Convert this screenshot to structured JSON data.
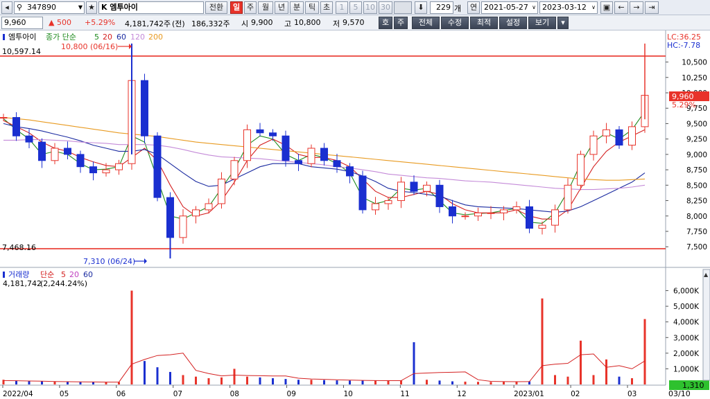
{
  "toolbar": {
    "code": "347890",
    "stock_prefix": "K",
    "stock_name": "엠투아이",
    "switch_label": "전환",
    "periods": [
      "일",
      "주",
      "월",
      "년",
      "분",
      "틱",
      "초"
    ],
    "active_period": "일",
    "minute_options": [
      "1",
      "5",
      "10",
      "30"
    ],
    "count_value": "229",
    "count_unit": "개",
    "span_label": "연",
    "date_from": "2021-05-27",
    "date_to": "2023-03-12"
  },
  "quote": {
    "price": "9,960",
    "change": "500",
    "change_pct": "+5.29%",
    "volume": "4,181,742주",
    "prev_label": "(전)",
    "prev_volume": "186,332주",
    "open_label": "시",
    "open": "9,900",
    "high_label": "고",
    "high": "10,800",
    "low_label": "저",
    "low": "9,570",
    "buttons": [
      "호",
      "주"
    ],
    "menus": [
      "전체",
      "수정",
      "최적",
      "설정",
      "보기"
    ]
  },
  "colors": {
    "up": "#e8332a",
    "down": "#1a2fd0",
    "ma5": "#1d8a1d",
    "ma20": "#d42020",
    "ma60": "#1a2aa0",
    "ma120": "#c48ad8",
    "ma200": "#e89a20"
  },
  "price_panel": {
    "legend_name": "엠투아이",
    "legend_type": "종가 단순",
    "ma_periods": [
      "5",
      "20",
      "60",
      "120",
      "200"
    ],
    "lc_label": "LC:36.25",
    "hc_label": "HC:-7.78",
    "current_price_tag": "9,960",
    "current_pct_tag": "5.29%",
    "high_line_label": "10,597.14",
    "low_line_label": "7,468.16",
    "max_annotation": "10,800 (06/16)",
    "min_annotation": "7,310 (06/24)"
  },
  "volume_panel": {
    "legend_name": "거래량",
    "legend_type": "단순",
    "ma_periods": [
      "5",
      "20",
      "60"
    ],
    "volume_value": "4,181,742",
    "volume_pct": "(2,244.24%)",
    "current_tag": "1,310",
    "corner_label": "03/10"
  },
  "chart_data": {
    "type": "candlestick",
    "title": "",
    "price_axis": {
      "ticks": [
        10500,
        10250,
        10000,
        9750,
        9500,
        9250,
        9000,
        8750,
        8500,
        8250,
        8000,
        7750,
        7500
      ],
      "tick_labels": [
        "10,500",
        "10,250",
        "10,000",
        "9,750",
        "9,500",
        "9,250",
        "9,000",
        "8,750",
        "8,500",
        "8,250",
        "8,000",
        "7,750",
        "7,500"
      ],
      "range": [
        7300,
        10900
      ]
    },
    "volume_axis": {
      "ticks": [
        6000000,
        5000000,
        4000000,
        3000000,
        2000000,
        1000000
      ],
      "tick_labels": [
        "6,000K",
        "5,000K",
        "4,000K",
        "3,000K",
        "2,000K",
        "1,000K"
      ],
      "range": [
        0,
        6600000
      ]
    },
    "x_axis": {
      "labels": [
        "2022/04",
        "05",
        "06",
        "07",
        "08",
        "09",
        "10",
        "11",
        "12",
        "2023/01",
        "02",
        "03"
      ]
    },
    "reference_lines": [
      10597.14,
      7468.16
    ],
    "price_series": [
      {
        "name": "엠투아이",
        "close": [
          9600,
          9300,
          9200,
          8900,
          9100,
          9000,
          8800,
          8700,
          8750,
          8850,
          10200,
          9300,
          8300,
          7650,
          8000,
          8100,
          8200,
          8600,
          8900,
          9400,
          9350,
          9300,
          8900,
          8850,
          9100,
          8900,
          8800,
          8650,
          8100,
          8200,
          8250,
          8550,
          8400,
          8500,
          8150,
          8000,
          8000,
          8050,
          8050,
          8100,
          8150,
          7800,
          7850,
          8100,
          8500,
          9000,
          9300,
          9400,
          9150,
          9450,
          9960
        ]
      },
      {
        "name": "5",
        "values": [
          9580,
          9400,
          9250,
          9000,
          9050,
          9000,
          8850,
          8750,
          8760,
          8800,
          9300,
          9200,
          8600,
          8000,
          7950,
          8050,
          8150,
          8450,
          8750,
          9150,
          9300,
          9250,
          9000,
          8900,
          9000,
          8950,
          8850,
          8700,
          8300,
          8200,
          8250,
          8450,
          8420,
          8450,
          8250,
          8050,
          8020,
          8040,
          8050,
          8090,
          8120,
          7900,
          7880,
          8050,
          8400,
          8850,
          9200,
          9350,
          9250,
          9400,
          9700
        ]
      },
      {
        "name": "20",
        "values": [
          9550,
          9450,
          9350,
          9200,
          9100,
          9050,
          8950,
          8880,
          8820,
          8800,
          8950,
          9100,
          8900,
          8500,
          8150,
          8000,
          8050,
          8250,
          8550,
          8900,
          9150,
          9250,
          9150,
          9000,
          8950,
          8950,
          8900,
          8800,
          8600,
          8400,
          8300,
          8300,
          8350,
          8400,
          8350,
          8200,
          8100,
          8050,
          8050,
          8050,
          8100,
          8000,
          7950,
          7950,
          8100,
          8450,
          8800,
          9050,
          9200,
          9300,
          9400
        ]
      },
      {
        "name": "60",
        "values": [
          9500,
          9450,
          9420,
          9380,
          9330,
          9280,
          9220,
          9150,
          9100,
          9050,
          9050,
          9080,
          9000,
          8850,
          8700,
          8560,
          8480,
          8500,
          8600,
          8700,
          8800,
          8850,
          8850,
          8850,
          8800,
          8780,
          8760,
          8720,
          8650,
          8560,
          8450,
          8400,
          8380,
          8350,
          8320,
          8250,
          8180,
          8150,
          8140,
          8130,
          8120,
          8100,
          8080,
          8060,
          8080,
          8150,
          8250,
          8350,
          8450,
          8550,
          8700
        ]
      },
      {
        "name": "120",
        "values": [
          9230,
          9230,
          9240,
          9240,
          9230,
          9220,
          9200,
          9190,
          9180,
          9160,
          9160,
          9160,
          9150,
          9120,
          9080,
          9030,
          8990,
          8960,
          8950,
          8940,
          8930,
          8910,
          8890,
          8870,
          8850,
          8830,
          8800,
          8780,
          8750,
          8720,
          8680,
          8660,
          8640,
          8620,
          8610,
          8590,
          8570,
          8560,
          8550,
          8530,
          8510,
          8490,
          8470,
          8450,
          8440,
          8430,
          8430,
          8440,
          8450,
          8470,
          8500
        ]
      },
      {
        "name": "200",
        "values": [
          9600,
          9580,
          9560,
          9530,
          9500,
          9470,
          9440,
          9410,
          9380,
          9350,
          9330,
          9310,
          9290,
          9260,
          9230,
          9200,
          9180,
          9160,
          9140,
          9120,
          9100,
          9080,
          9060,
          9040,
          9020,
          9000,
          8980,
          8960,
          8940,
          8920,
          8900,
          8880,
          8860,
          8840,
          8820,
          8800,
          8780,
          8760,
          8740,
          8720,
          8700,
          8680,
          8660,
          8640,
          8620,
          8600,
          8590,
          8580,
          8580,
          8590,
          8600
        ]
      }
    ],
    "volume_series": [
      {
        "name": "거래량",
        "values": [
          300000,
          250000,
          200000,
          200000,
          180000,
          170000,
          150000,
          150000,
          140000,
          150000,
          6000000,
          1500000,
          1100000,
          800000,
          600000,
          500000,
          400000,
          450000,
          1000000,
          500000,
          450000,
          400000,
          350000,
          300000,
          300000,
          280000,
          260000,
          250000,
          250000,
          240000,
          230000,
          250000,
          2700000,
          300000,
          250000,
          200000,
          180000,
          170000,
          160000,
          170000,
          180000,
          200000,
          5500000,
          600000,
          500000,
          2800000,
          600000,
          1600000,
          500000,
          400000,
          4181742
        ]
      },
      {
        "name": "5",
        "values": [
          250000,
          240000,
          220000,
          210000,
          190000,
          175000,
          165000,
          160000,
          152000,
          150000,
          1300000,
          1600000,
          1850000,
          1900000,
          2000000,
          900000,
          700000,
          550000,
          600000,
          570000,
          560000,
          540000,
          540000,
          400000,
          350000,
          330000,
          300000,
          280000,
          260000,
          250000,
          245000,
          245000,
          700000,
          730000,
          760000,
          780000,
          800000,
          300000,
          200000,
          180000,
          175000,
          180000,
          1200000,
          1300000,
          1350000,
          1900000,
          1950000,
          1100000,
          1200000,
          1000000,
          1500000
        ]
      }
    ]
  }
}
